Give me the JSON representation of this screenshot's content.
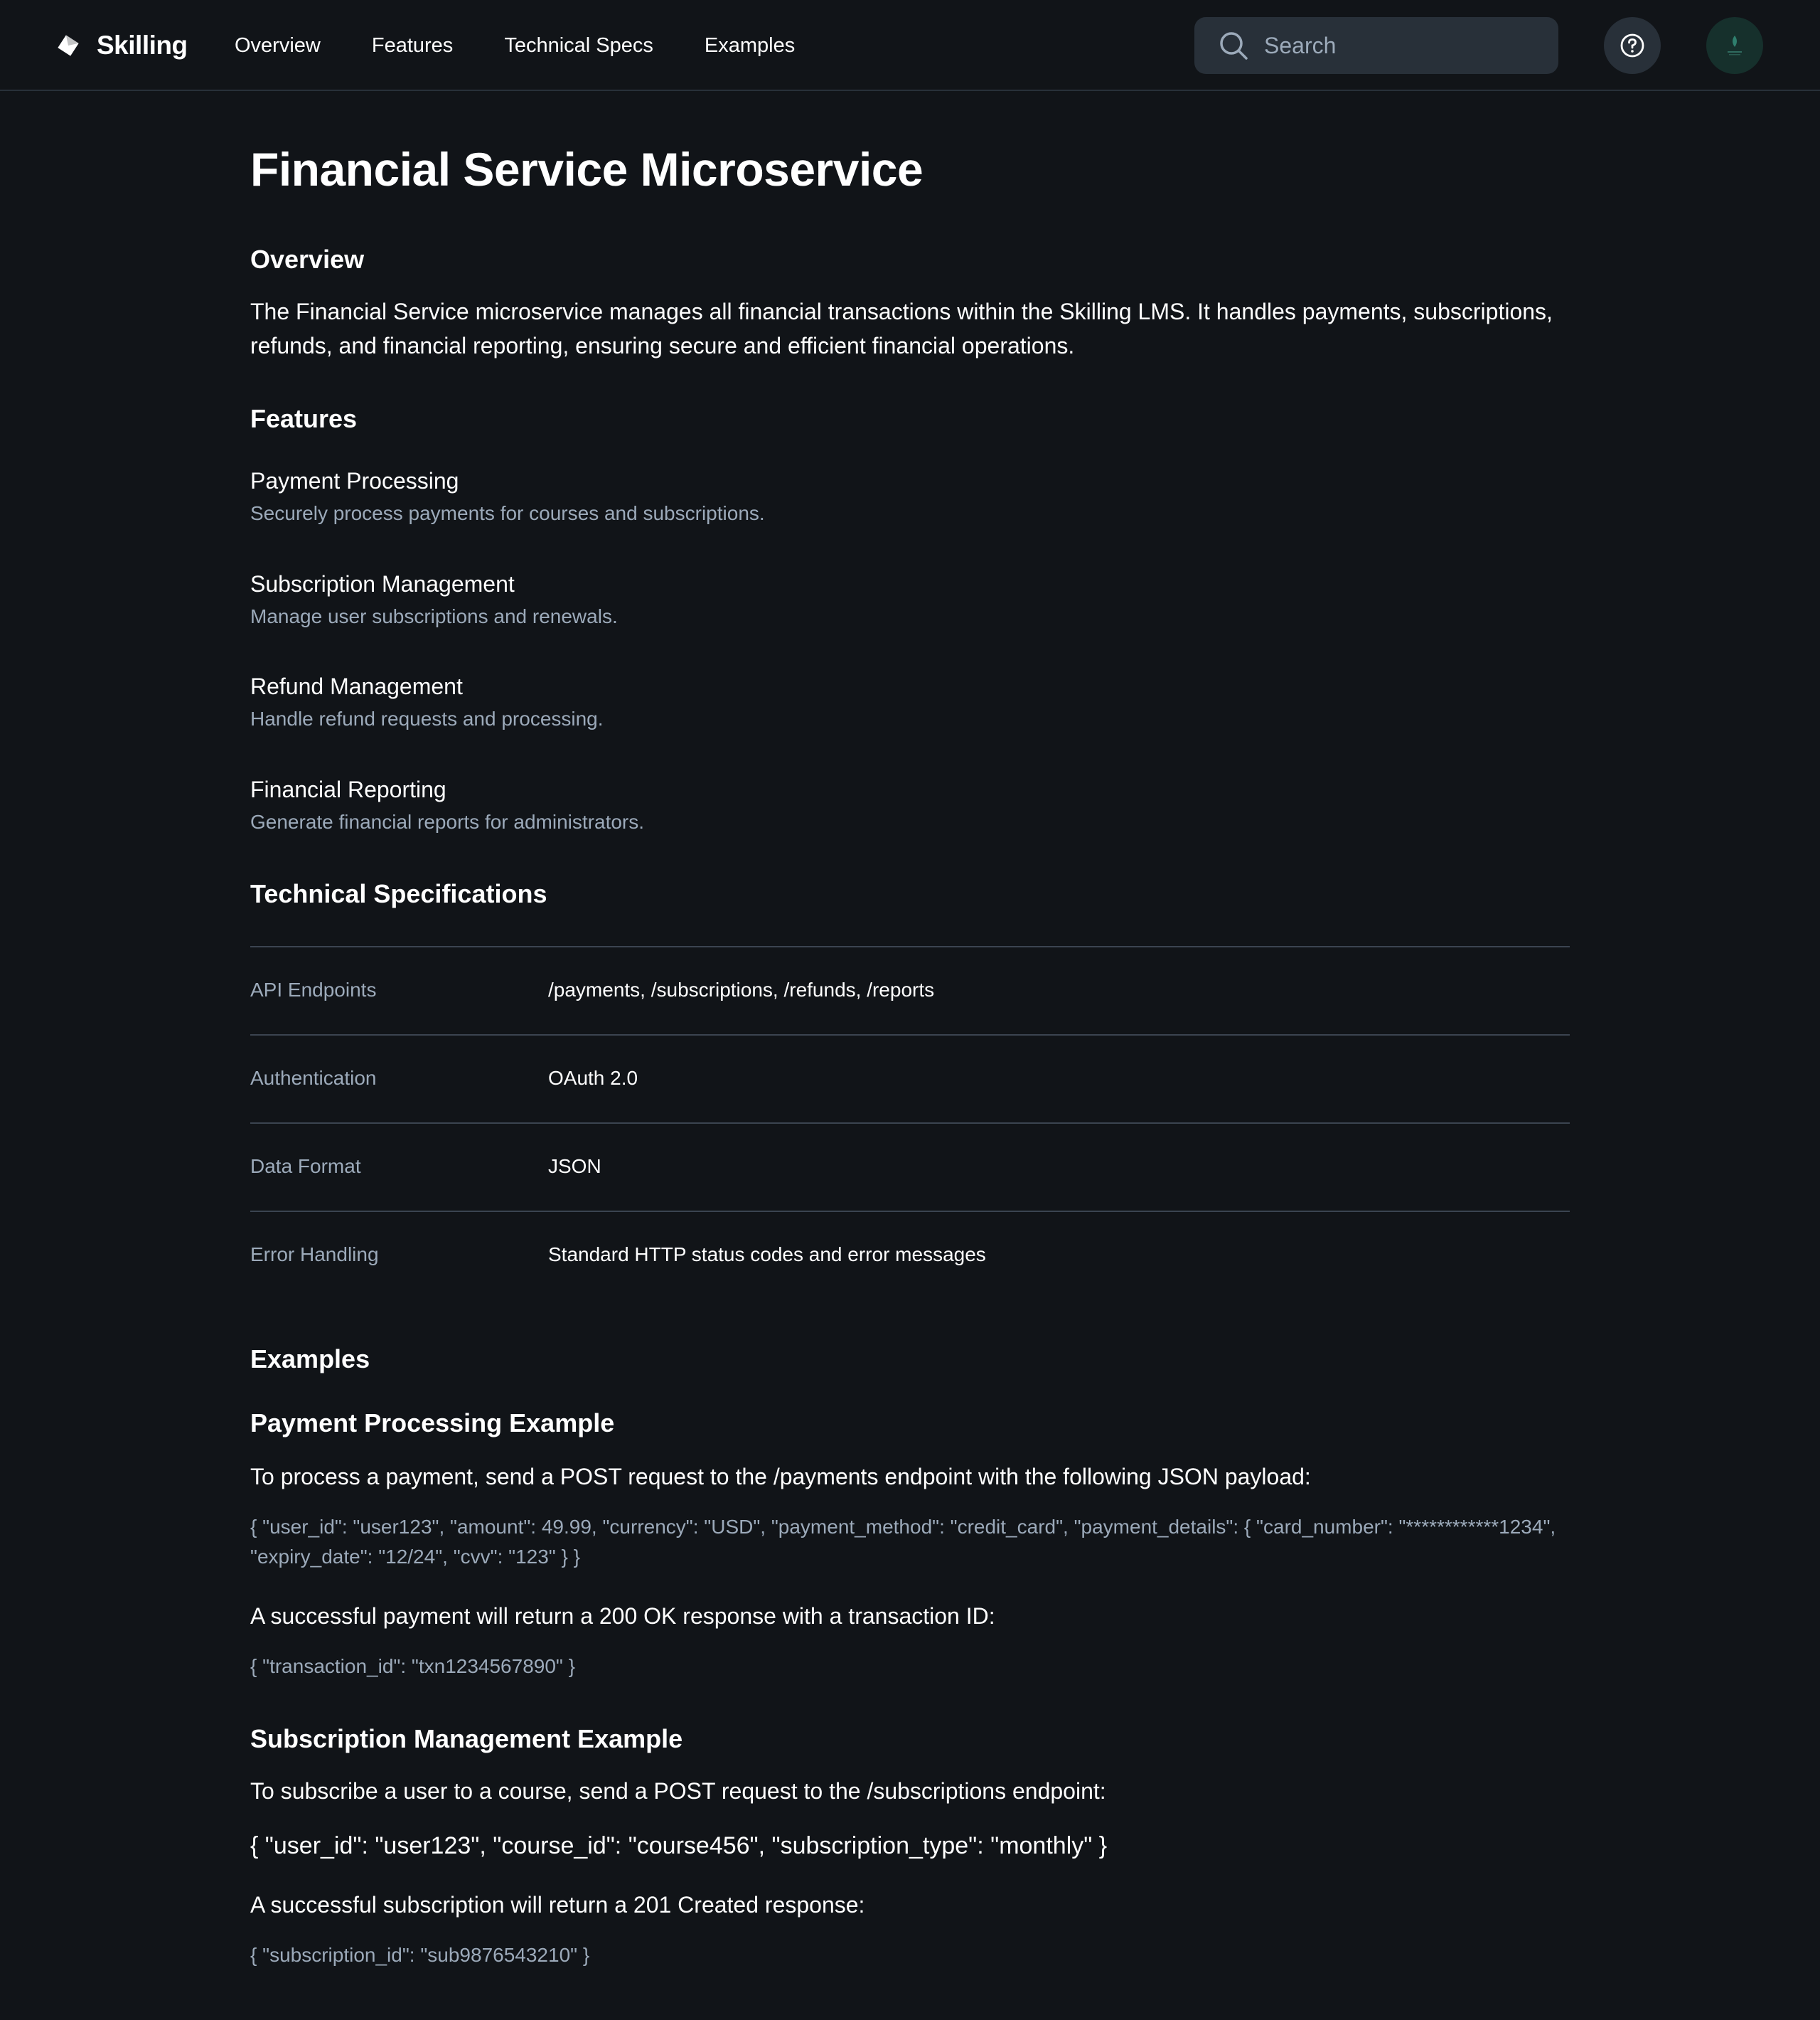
{
  "header": {
    "brand_name": "Skilling",
    "nav": [
      "Overview",
      "Features",
      "Technical Specs",
      "Examples"
    ],
    "search_placeholder": "Search"
  },
  "page": {
    "title": "Financial Service Microservice",
    "overview_heading": "Overview",
    "overview_text": "The Financial Service microservice manages all financial transactions within the Skilling LMS. It handles payments, subscriptions, refunds, and financial reporting, ensuring secure and efficient financial operations.",
    "features_heading": "Features",
    "features": [
      {
        "title": "Payment Processing",
        "desc": "Securely process payments for courses and subscriptions."
      },
      {
        "title": "Subscription Management",
        "desc": "Manage user subscriptions and renewals."
      },
      {
        "title": "Refund Management",
        "desc": "Handle refund requests and processing."
      },
      {
        "title": "Financial Reporting",
        "desc": "Generate financial reports for administrators."
      }
    ],
    "specs_heading": "Technical Specifications",
    "specs": [
      {
        "label": "API Endpoints",
        "value": "/payments, /subscriptions, /refunds, /reports"
      },
      {
        "label": "Authentication",
        "value": "OAuth 2.0"
      },
      {
        "label": "Data Format",
        "value": "JSON"
      },
      {
        "label": "Error Handling",
        "value": "Standard HTTP status codes and error messages"
      }
    ],
    "examples_heading": "Examples",
    "payment_example": {
      "heading": "Payment Processing Example",
      "intro": "To process a payment, send a POST request to the /payments endpoint with the following JSON payload:",
      "payload": "{ \"user_id\": \"user123\", \"amount\": 49.99, \"currency\": \"USD\", \"payment_method\": \"credit_card\", \"payment_details\": { \"card_number\": \"************1234\", \"expiry_date\": \"12/24\", \"cvv\": \"123\" } }",
      "result_text": "A successful payment will return a 200 OK response with a transaction ID:",
      "response": "{ \"transaction_id\": \"txn1234567890\" }"
    },
    "subscription_example": {
      "heading": "Subscription Management Example",
      "intro": "To subscribe a user to a course, send a POST request to the /subscriptions endpoint:",
      "payload": "{ \"user_id\": \"user123\", \"course_id\": \"course456\", \"subscription_type\": \"monthly\" }",
      "result_text": "A successful subscription will return a 201 Created response:",
      "response": "{ \"subscription_id\": \"sub9876543210\" }"
    }
  },
  "colors": {
    "background": "#111418",
    "surface": "#283039",
    "text": "#ffffff",
    "muted_text": "#9caaba",
    "divider": "#3b4450"
  },
  "icons": {
    "brand": "skilling-logo-icon",
    "search": "search-icon",
    "help": "question-circle-icon",
    "avatar": "avatar"
  }
}
